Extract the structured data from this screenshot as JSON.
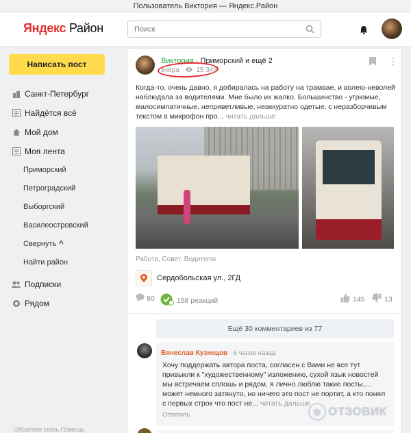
{
  "window": {
    "title": "Пользователь Виктория — Яндекс.Район"
  },
  "header": {
    "logo_ya": "Яндекс",
    "logo_rest": "Район",
    "search_placeholder": "Поиск"
  },
  "sidebar": {
    "write_button": "Написать пост",
    "items": [
      {
        "label": "Санкт-Петербург",
        "icon": "city-icon"
      },
      {
        "label": "Найдётся всё",
        "icon": "list-icon"
      },
      {
        "label": "Мой дом",
        "icon": "home-icon"
      },
      {
        "label": "Моя лента",
        "icon": "feed-icon"
      }
    ],
    "sub_items": [
      "Приморский",
      "Петроградский",
      "Выборгский",
      "Василеостровский"
    ],
    "collapse_label": "Свернуть",
    "find_area": "Найти район",
    "bottom_items": [
      {
        "label": "Подписки",
        "icon": "people-icon"
      },
      {
        "label": "Рядом",
        "icon": "pin-icon"
      }
    ],
    "footer": "Обратная связь   Помощь"
  },
  "post": {
    "author": "Виктория",
    "separator": " · ",
    "location": "Приморский и ещё 2",
    "date": "вчера",
    "views": "15 343",
    "text": "Когда-то, очень давно, я добиралась на работу на трамвае, и волею-неволей наблюдала за водителями. Мне было их жалко. Большинство - угрюмые, малосимпатичные, неприветливые, неаккуратно одетые, с неразборчивым текстом в микрофон про...",
    "read_more": "читать дальше",
    "tags": "Работа, Совет, Водителю",
    "place": "Сердобольская ул., 2ГД",
    "comments_count": "80",
    "reactions": "158 реакций",
    "likes": "145",
    "dislikes": "13"
  },
  "comments": {
    "more_label": "Ещё 30 комментариев из 77",
    "items": [
      {
        "author": "Вячеслав Кузнецов",
        "time": "6 часов назад",
        "text": "Хочу поддержать автора поста, согласен с Вами не все тут привыкли к \"художественному\" изложению, сухой язык новостей мы встречаем сплошь и рядом, я лично люблю такие посты,... может немного затянуто, но ничего это пост не портит, а кто понял с первых строк что пост не...",
        "read_more": "читать дальше",
        "reply": "Ответить"
      }
    ]
  },
  "watermark": "ОТЗОВИК",
  "colors": {
    "accent": "#ffdb4d",
    "author_green": "#2ca446",
    "highlight_red": "#e8232b",
    "comment_author": "#e0622b"
  }
}
